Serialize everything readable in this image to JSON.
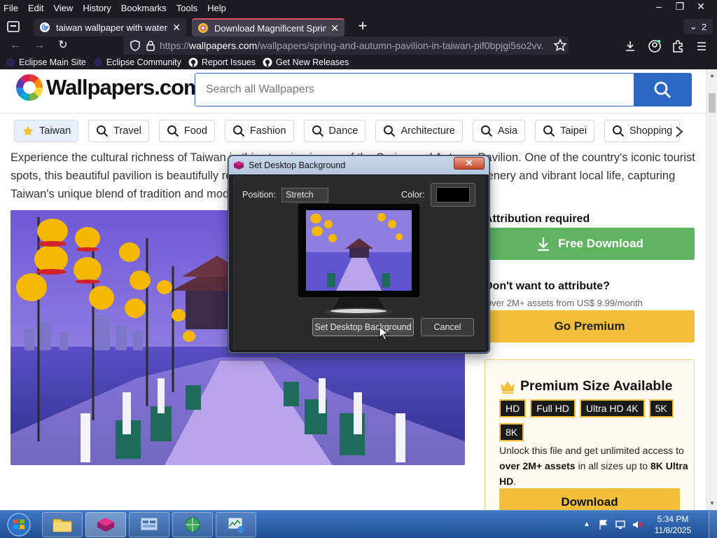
{
  "menubar": {
    "items": [
      {
        "label": "File",
        "key": "F"
      },
      {
        "label": "Edit",
        "key": "E"
      },
      {
        "label": "View",
        "key": "V"
      },
      {
        "label": "History",
        "key": "s"
      },
      {
        "label": "Bookmarks",
        "key": "B"
      },
      {
        "label": "Tools",
        "key": "T"
      },
      {
        "label": "Help",
        "key": "H"
      }
    ]
  },
  "tabs": [
    {
      "label": "taiwan wallpaper with watermar",
      "icon": "google-icon"
    },
    {
      "label": "Download Magnificent Spring a",
      "icon": "wallpapers-favicon"
    }
  ],
  "tab_count": "2",
  "url": {
    "scheme": "https://",
    "host": "wallpapers.com",
    "path": "/wallpapers/spring-and-autumn-pavilion-in-taiwan-pif0bpjgi5so2vv."
  },
  "bookmarks": [
    {
      "label": "Eclipse Main Site",
      "icon": "eclipse-icon"
    },
    {
      "label": "Eclipse Community",
      "icon": "eclipse-icon"
    },
    {
      "label": "Report Issues",
      "icon": "github-icon"
    },
    {
      "label": "Get New Releases",
      "icon": "github-icon"
    }
  ],
  "site": {
    "logo_text": "Wallpapers.com",
    "search_placeholder": "Search all Wallpapers",
    "chips": [
      "Taiwan",
      "Travel",
      "Food",
      "Fashion",
      "Dance",
      "Architecture",
      "Asia",
      "Taipei",
      "Shopping"
    ],
    "description": "Experience the cultural richness of Taiwan in this stunning image of the Spring and Autumn Pavilion. One of the country's iconic tourist spots, this beautiful pavilion is beautifully reflected in the calm waters, surrounded by lush greenery and vibrant local life, capturing Taiwan's unique blend of tradition and modernity."
  },
  "sidebar": {
    "attribution_title": "Attribution required",
    "free_download": "Free Download",
    "dont_title": "Don't want to attribute?",
    "dont_sub": "Over 2M+ assets from US$ 9.99/month",
    "go_premium": "Go Premium",
    "premium_title": "Premium Size Available",
    "sizes": [
      "HD",
      "Full HD",
      "Ultra HD 4K",
      "5K",
      "8K"
    ],
    "premium_text_1": "Unlock this file and get unlimited access to ",
    "premium_text_bold_1": "over 2M+ assets",
    "premium_text_2": " in all sizes up to ",
    "premium_text_bold_2": "8K Ultra HD",
    "premium_text_3": ".",
    "download": "Download"
  },
  "dialog": {
    "title": "Set Desktop Background",
    "position_label": "Position:",
    "position_value": "Stretch",
    "color_label": "Color:",
    "color_value": "#000000",
    "set_button": "Set Desktop Background",
    "cancel_button": "Cancel"
  },
  "taskbar": {
    "time": "5:34 PM",
    "date": "11/8/2025"
  },
  "colors": {
    "accent_blue": "#2b67c5",
    "free_green": "#60b361",
    "premium_yellow": "#f3bf3a"
  }
}
